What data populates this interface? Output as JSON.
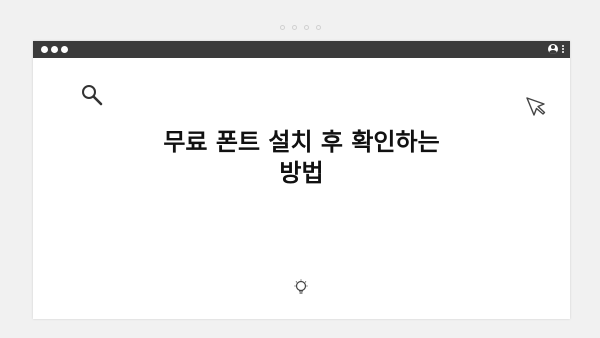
{
  "page": {
    "title": "무료 폰트 설치 후 확인하는 방법"
  },
  "icons": {
    "search": "search-icon",
    "cursor": "cursor-icon",
    "lightbulb": "lightbulb-icon",
    "user": "user-icon",
    "menu": "kebab-menu-icon"
  },
  "colors": {
    "titlebar": "#3b3b3b",
    "background": "#f1f1f1",
    "window": "#ffffff",
    "title_text": "#111111"
  }
}
